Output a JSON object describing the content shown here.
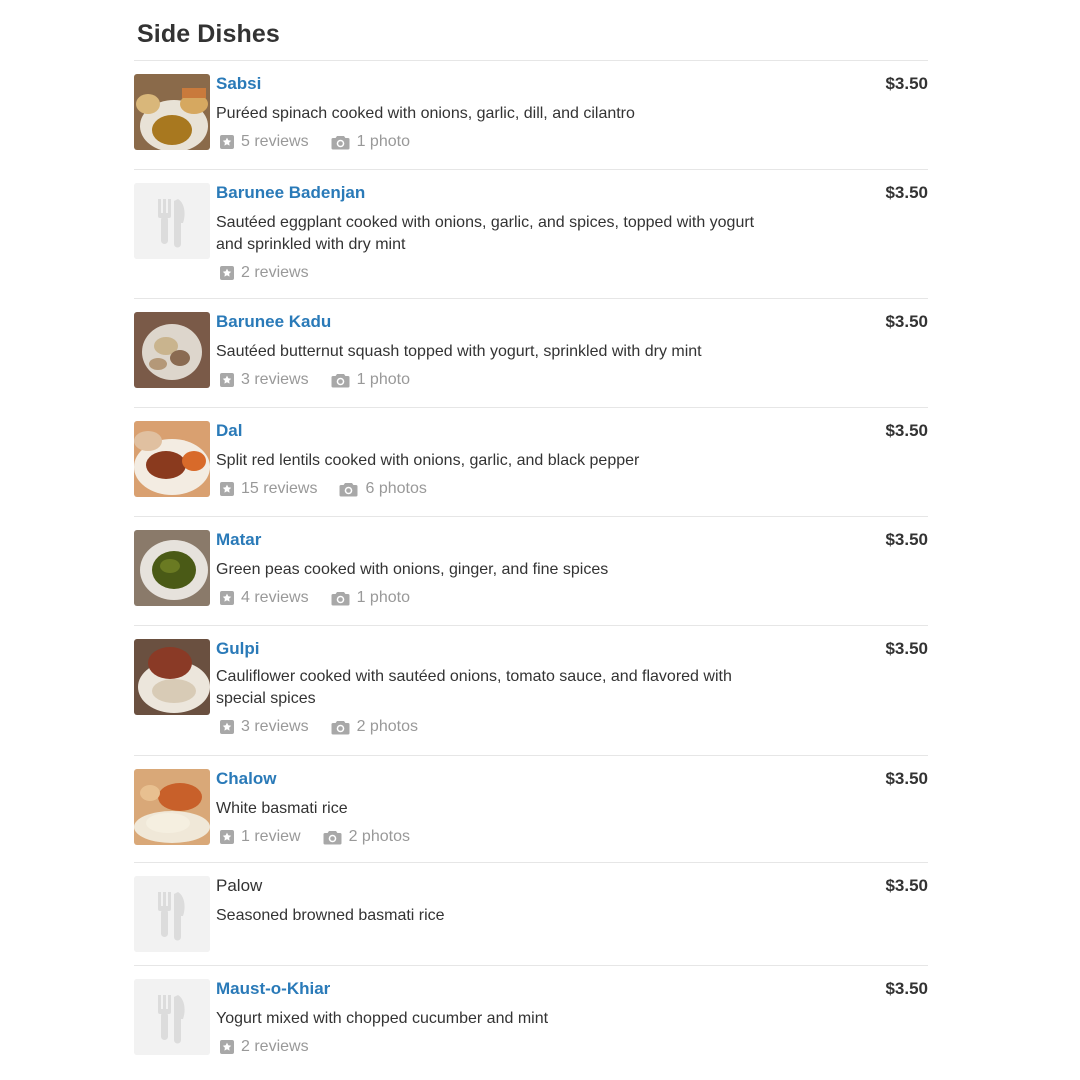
{
  "section": {
    "title": "Side Dishes"
  },
  "items": [
    {
      "name": "Sabsi",
      "linked": true,
      "description": "Puréed spinach cooked with onions, garlic, dill, and cilantro",
      "price": "$3.50",
      "reviews": "5 reviews",
      "photos": "1 photo",
      "photo": "food-photo"
    },
    {
      "name": "Barunee Badenjan",
      "linked": true,
      "description": "Sautéed eggplant cooked with onions, garlic, and spices, topped with yogurt and sprinkled with dry mint",
      "price": "$3.50",
      "reviews": "2 reviews",
      "photos": "",
      "photo": "placeholder"
    },
    {
      "name": "Barunee Kadu",
      "linked": true,
      "description": "Sautéed butternut squash topped with yogurt, sprinkled with dry mint",
      "price": "$3.50",
      "reviews": "3 reviews",
      "photos": "1 photo",
      "photo": "food-photo"
    },
    {
      "name": "Dal",
      "linked": true,
      "description": "Split red lentils cooked with onions, garlic, and black pepper",
      "price": "$3.50",
      "reviews": "15 reviews",
      "photos": "6 photos",
      "photo": "food-photo"
    },
    {
      "name": "Matar",
      "linked": true,
      "description": "Green peas cooked with onions, ginger, and fine spices",
      "price": "$3.50",
      "reviews": "4 reviews",
      "photos": "1 photo",
      "photo": "food-photo"
    },
    {
      "name": "Gulpi",
      "linked": true,
      "description": "Cauliflower cooked with sautéed onions, tomato sauce, and flavored with special spices",
      "price": "$3.50",
      "reviews": "3 reviews",
      "photos": "2 photos",
      "photo": "food-photo"
    },
    {
      "name": "Chalow",
      "linked": true,
      "description": "White basmati rice",
      "price": "$3.50",
      "reviews": "1 review",
      "photos": "2 photos",
      "photo": "food-photo"
    },
    {
      "name": "Palow",
      "linked": false,
      "description": "Seasoned browned basmati rice",
      "price": "$3.50",
      "reviews": "",
      "photos": "",
      "photo": "placeholder"
    },
    {
      "name": "Maust-o-Khiar",
      "linked": true,
      "description": "Yogurt mixed with chopped cucumber and mint",
      "price": "$3.50",
      "reviews": "2 reviews",
      "photos": "",
      "photo": "placeholder"
    }
  ],
  "icons": {
    "review": "star-icon",
    "photo": "camera-icon",
    "placeholder": "fork-knife-icon"
  },
  "colors": {
    "link": "#2a7ab8",
    "text": "#333333",
    "meta": "#999999",
    "divider": "#e6e6e6"
  }
}
